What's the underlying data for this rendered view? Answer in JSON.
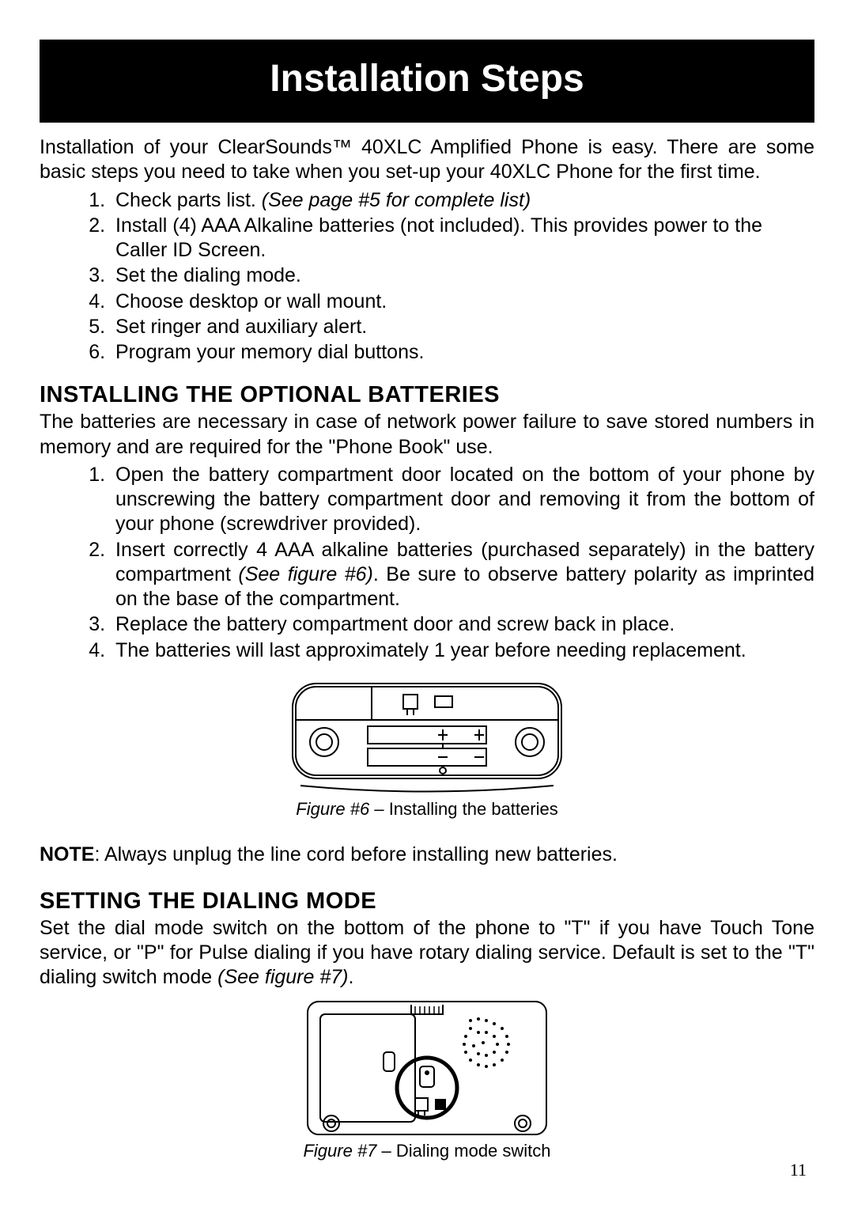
{
  "title": "Installation Steps",
  "intro": "Installation of your ClearSounds™ 40XLC Amplified Phone is easy. There are some basic steps you need to take when you set-up your 40XLC Phone for the first time.",
  "steps": {
    "s1a": "Check parts list. ",
    "s1b": "(See page #5 for complete list)",
    "s2": "Install (4) AAA Alkaline batteries (not included). This provides power to the Caller ID Screen.",
    "s3": "Set the dialing mode.",
    "s4": "Choose desktop or wall mount.",
    "s5": "Set ringer and auxiliary alert.",
    "s6": "Program your memory dial buttons."
  },
  "batt": {
    "heading": "INSTALLING THE OPTIONAL BATTERIES",
    "intro": "The batteries are necessary in case of network power failure to save stored numbers in memory and are required for the \"Phone Book\" use.",
    "li1": "Open the battery compartment door located on the bottom of your phone by unscrewing the battery compartment door and removing it from the bottom of your phone (screwdriver provided).",
    "li2a": "Insert correctly 4 AAA alkaline batteries (purchased separately) in the battery compartment ",
    "li2b": "(See figure #6)",
    "li2c": ". Be sure to observe battery polarity as imprinted on the base of the compartment.",
    "li3": "Replace the battery compartment door and screw back in place.",
    "li4": "The batteries will last approximately 1 year before needing replacement."
  },
  "fig6": {
    "label": "Figure #6",
    "text": " – Installing the batteries"
  },
  "note": {
    "label": "NOTE",
    "text": ": Always unplug the line cord before installing new batteries."
  },
  "dial": {
    "heading": "SETTING THE DIALING MODE",
    "text_a": "Set the dial mode switch on the bottom of the phone to \"T\" if you have Touch Tone service, or \"P\" for Pulse dialing if you have rotary dialing service. Default is set to the \"T\" dialing switch mode ",
    "text_b": "(See figure #7)",
    "text_c": "."
  },
  "fig7": {
    "label": "Figure #7",
    "text": " – Dialing mode switch"
  },
  "page_number": "11"
}
